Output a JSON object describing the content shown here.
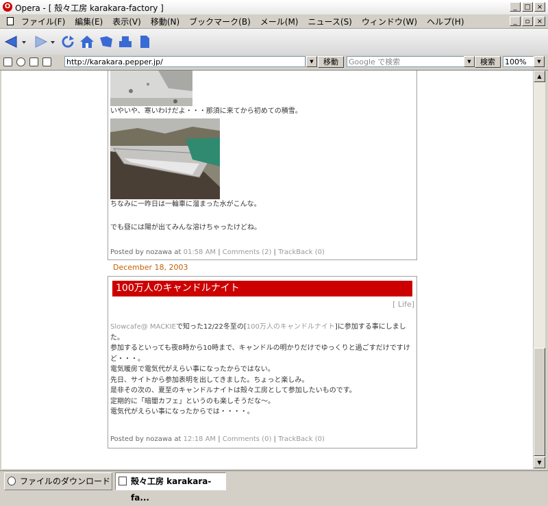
{
  "window": {
    "title": "Opera - [ 殻々工房 karakara-factory ]"
  },
  "menu": {
    "items": [
      "ファイル(F)",
      "編集(E)",
      "表示(V)",
      "移動(N)",
      "ブックマーク(B)",
      "メール(M)",
      "ニュース(S)",
      "ウィンドウ(W)",
      "ヘルプ(H)"
    ]
  },
  "address": {
    "url": "http://karakara.pepper.jp/",
    "go_label": "移動",
    "search_placeholder": "Google で検索",
    "search_label": "検索",
    "zoom": "100%"
  },
  "post1": {
    "caption1": "いやいや、寒いわけだよ・・・那須に来てから初めての積雪。",
    "caption2": "ちなみに一昨日は一輪車に溜まった水がこんな。",
    "caption3": "でも昼には陽が出てみんな溶けちゃったけどね。",
    "footer_prefix": "Posted by nozawa at ",
    "time": "01:58 AM",
    "comments": "Comments (2)",
    "trackback": "TrackBack (0)",
    "sep": " | "
  },
  "date_label": "December 18, 2003",
  "post2": {
    "title": "100万人のキャンドルナイト",
    "category": "[ Life]",
    "link_slowcafe": "Slowcafe@ MACKIE",
    "text_a": "で知った12/22冬至の[",
    "link_candle": "100万人のキャンドルナイト",
    "text_b": "]に参加する事にしました。",
    "lines": [
      "参加するといっても夜8時から10時まで、キャンドルの明かりだけでゆっくりと過ごすだけですけど・・・。",
      "電気暖房で電気代がえらい事になったからではない。",
      "先日、サイトから参加表明を出してきました。ちょっと楽しみ。",
      "是非その次の、夏至のキャンドルナイトは殻々工房として参加したいものです。",
      "定期的に「暗闇カフェ」というのも楽しそうだな～。",
      "電気代がえらい事になったからでは・・・・。"
    ],
    "footer_prefix": "Posted by nozawa at ",
    "time": "12:18 AM",
    "comments": "Comments (0)",
    "trackback": "TrackBack (0)",
    "sep": " | "
  },
  "statusbar": {
    "downloads_tab": "ファイルのダウンロード",
    "page_tab": "殻々工房 karakara-fa..."
  },
  "colors": {
    "title_red": "#cc0000",
    "date_orange": "#c06000"
  }
}
